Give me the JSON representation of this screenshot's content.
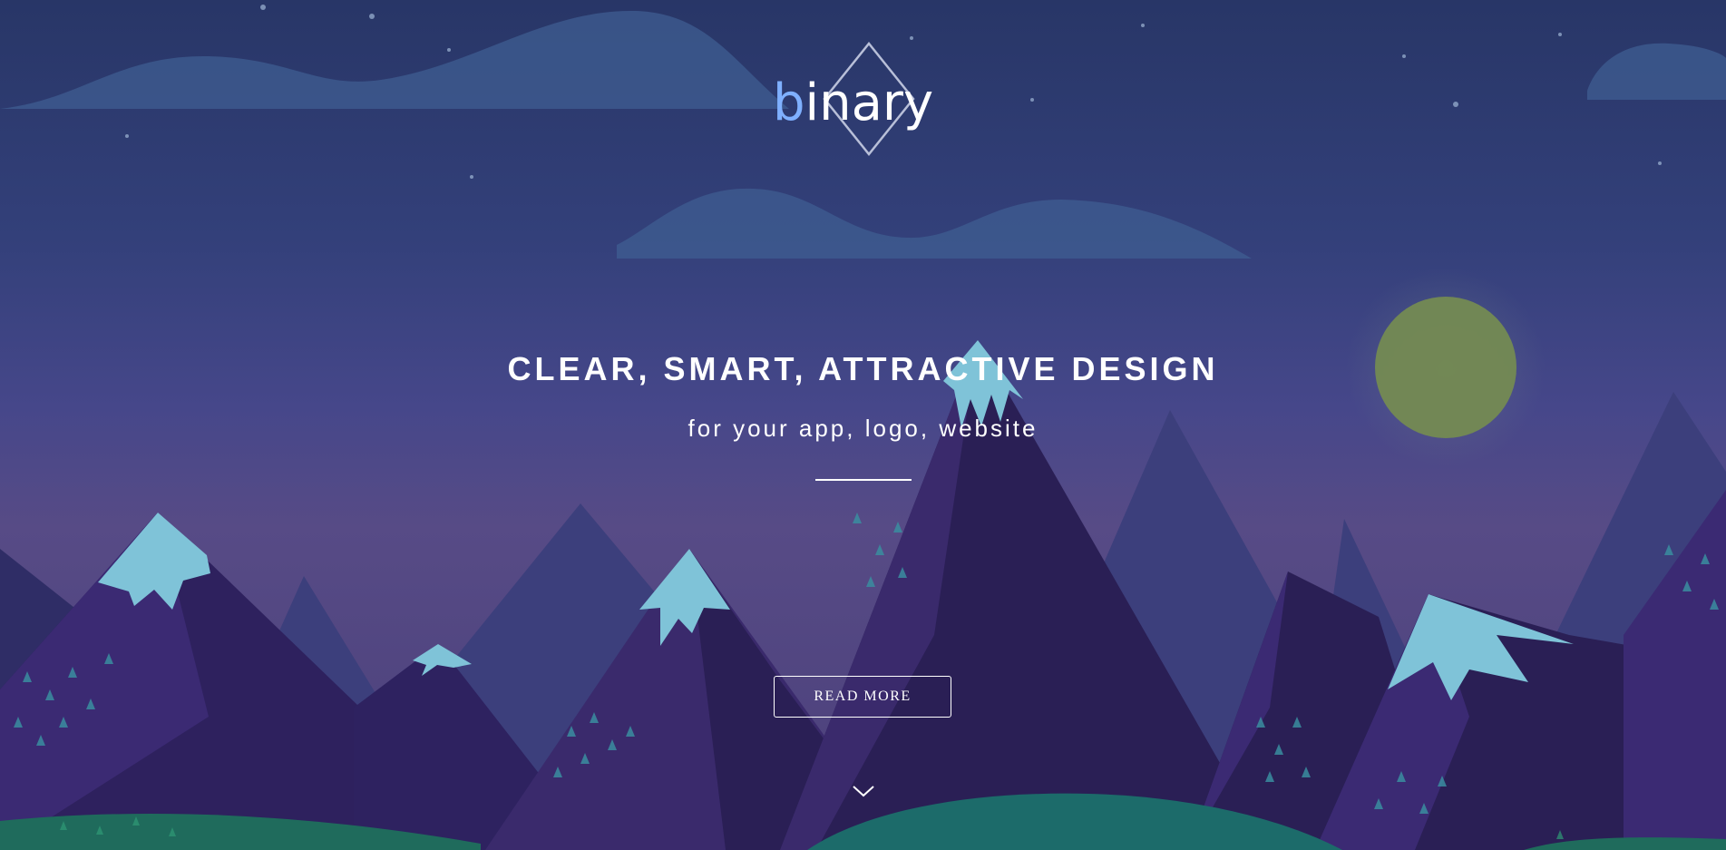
{
  "logo": {
    "prefix": "b",
    "rest": "inary",
    "icon": "diamond-logo-mark"
  },
  "hero": {
    "headline": "CLEAR, SMART, ATTRACTIVE DESIGN",
    "subline": "for your app, logo, website",
    "button_label": "READ MORE",
    "scroll_icon": "chevron-down-icon"
  },
  "colors": {
    "sky_top": "#283667",
    "sky_bottom": "#574b86",
    "moon": "#7d8a4f",
    "snow": "#7fc3d8",
    "mountain_dark": "#241d47",
    "mountain_mid": "#3a2a6c",
    "hill": "#1e6a66",
    "text": "#ffffff"
  }
}
